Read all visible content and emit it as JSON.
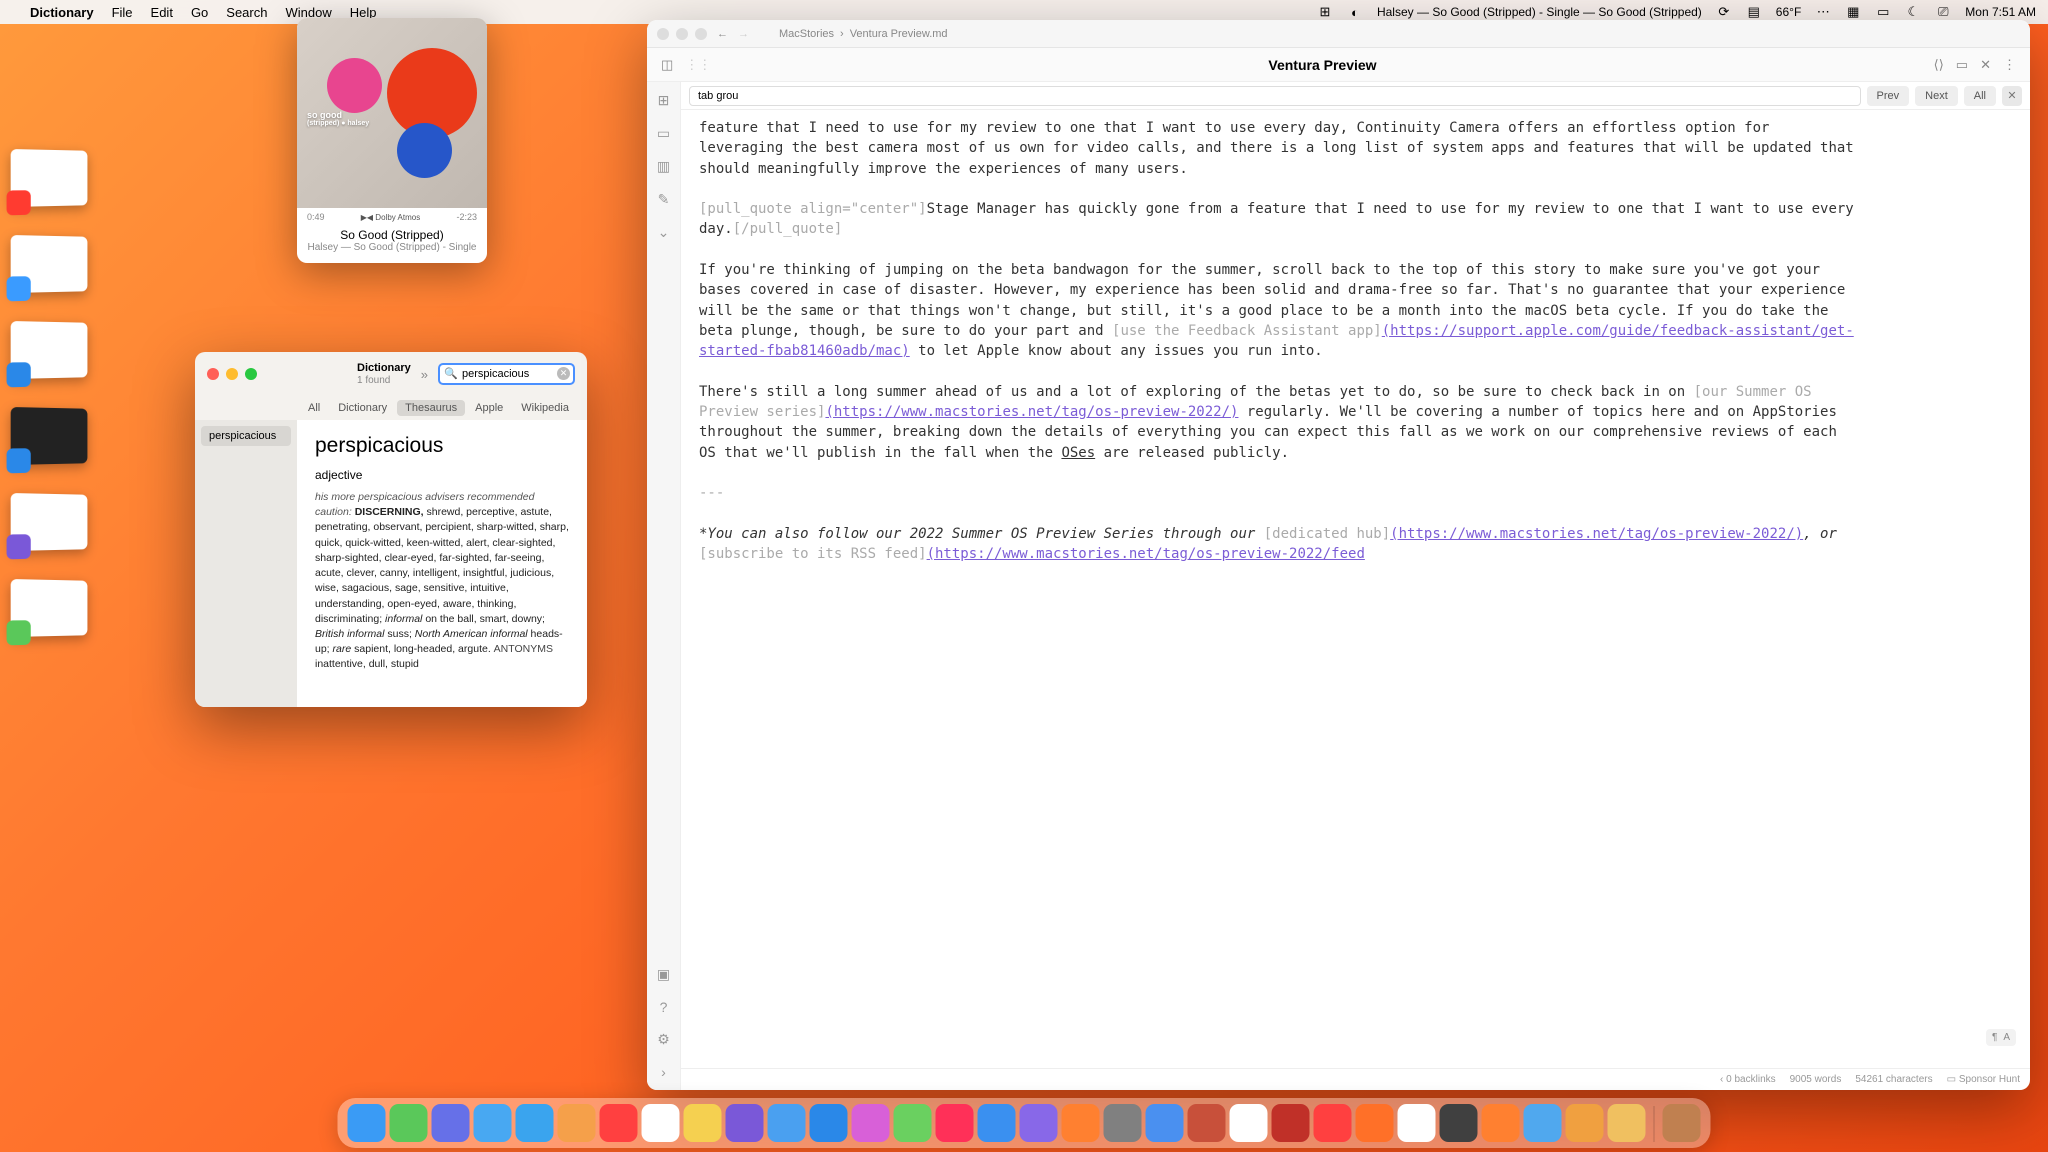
{
  "menubar": {
    "app": "Dictionary",
    "items": [
      "File",
      "Edit",
      "Go",
      "Search",
      "Window",
      "Help"
    ],
    "now_playing": "Halsey — So Good (Stripped) - Single — So Good (Stripped)",
    "weather": "66°F",
    "clock": "Mon 7:51 AM"
  },
  "music": {
    "art_text_line1": "so good",
    "art_text_line2": "(stripped) ● halsey",
    "elapsed": "0:49",
    "dolby": "▶◀ Dolby Atmos",
    "remaining": "-2:23",
    "title": "So Good (Stripped)",
    "subtitle": "Halsey — So Good (Stripped) - Single"
  },
  "dictionary": {
    "window_title": "Dictionary",
    "found": "1 found",
    "search_value": "perspicacious",
    "tabs": [
      "All",
      "Dictionary",
      "Thesaurus",
      "Apple",
      "Wikipedia"
    ],
    "active_tab": "Thesaurus",
    "sidebar_item": "perspicacious",
    "word": "perspicacious",
    "pos": "adjective",
    "example": "his more perspicacious advisers recommended caution:",
    "lead_syn": "DISCERNING",
    "synonyms": "shrewd, perceptive, astute, penetrating, observant, percipient, sharp-witted, sharp, quick, quick-witted, keen-witted, alert, clear-sighted, sharp-sighted, clear-eyed, far-sighted, far-seeing, acute, clever, canny, intelligent, insightful, judicious, wise, sagacious, sage, sensitive, intuitive, understanding, open-eyed, aware, thinking, discriminating;",
    "informal_label": "informal",
    "informal_syns": "on the ball, smart, downy;",
    "brit_label": "British informal",
    "brit_syns": "suss;",
    "na_label": "North American informal",
    "na_syns": "heads-up;",
    "rare_label": "rare",
    "rare_syns": "sapient, long-headed, argute.",
    "antonyms_label": "ANTONYMS",
    "antonyms": "inattentive, dull, stupid"
  },
  "editor": {
    "crumb1": "MacStories",
    "crumb2": "Ventura Preview.md",
    "title": "Ventura Preview",
    "find_value": "tab grou",
    "find_prev": "Prev",
    "find_next": "Next",
    "find_all": "All",
    "p1": "feature that I need to use for my review to one that I want to use every day, Continuity Camera offers an effortless option for leveraging the best camera most of us own for video calls, and there is a long list of system apps and features that will be updated that should meaningfully improve the experiences of many users.",
    "pq_open": "[pull_quote align=\"center\"]",
    "pq_body": "Stage Manager has quickly gone from a feature that I need to use for my review to one that I want to use every day.",
    "pq_close": "[/pull_quote]",
    "p2a": "If you're thinking of jumping on the beta bandwagon for the summer, scroll back to the top of this story to make sure you've got your bases covered in case of disaster. However, my experience has been solid and drama-free so far. That's no guarantee that your experience will be the same or that things won't change, but still, it's a good place to be a month into the macOS beta cycle. If you do take the beta plunge, though, be sure to do your part and ",
    "p2_linklabel": "[use the Feedback Assistant app]",
    "p2_linkurl": "(https://support.apple.com/guide/feedback-assistant/get-started-fbab81460adb/mac)",
    "p2b": " to let Apple know about any issues you run into.",
    "p3a": "There's still a long summer ahead of us and a lot of exploring of the betas yet to do, so be sure to check back in on ",
    "p3_linklabel": "[our Summer OS Preview series]",
    "p3_linkurl": "(https://www.macstories.net/tag/os-preview-2022/)",
    "p3b": " regularly. We'll be covering a number of topics here and on AppStories throughout the summer, breaking down the details of everything you can expect this fall as we work on our comprehensive reviews of each OS that we'll publish in the fall when the ",
    "p3_oses": "OSes",
    "p3c": " are released publicly.",
    "divider": "---",
    "p4a": "*You can also follow our 2022 Summer OS Preview Series through our ",
    "p4_l1label": "[dedicated hub]",
    "p4_l1url": "(https://www.macstories.net/tag/os-preview-2022/)",
    "p4b": ", or ",
    "p4_l2label": "[subscribe to its RSS feed]",
    "p4_l2url": "(https://www.macstories.net/tag/os-preview-2022/feed",
    "status_backlinks": "0 backlinks",
    "status_words": "9005 words",
    "status_chars": "54261 characters",
    "status_sponsor": "Sponsor Hunt",
    "float_label": "A"
  },
  "dock_colors": [
    "#3a9bf5",
    "#5ac85a",
    "#6670e8",
    "#48a8f2",
    "#3aa4ee",
    "#f5a04a",
    "#ff4040",
    "#fff",
    "#f5d050",
    "#7a58d8",
    "#4aa0f0",
    "#2a88e8",
    "#d860d8",
    "#6ad060",
    "#ff3058",
    "#3a90f0",
    "#8868e8",
    "#ff8030",
    "#808080",
    "#4a90f0",
    "#c8503a",
    "#fff",
    "#c03028",
    "#ff4040",
    "#ff7028",
    "#fff",
    "#404040",
    "#ff8030",
    "#50a8ee",
    "#f0a040",
    "#f0c060",
    "#c08050"
  ]
}
